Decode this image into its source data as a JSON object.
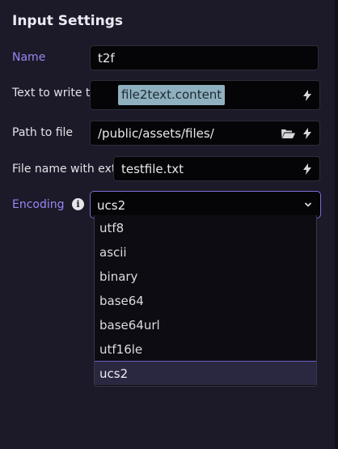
{
  "panel": {
    "title": "Input Settings"
  },
  "fields": {
    "name": {
      "label": "Name",
      "value": "t2f"
    },
    "text_to_write": {
      "label": "Text to write to file",
      "value": "file2text.content"
    },
    "path": {
      "label": "Path to file",
      "value": "/public/assets/files/"
    },
    "file_name": {
      "label": "File name with extn",
      "value": "testfile.txt"
    },
    "encoding": {
      "label": "Encoding",
      "value": "ucs2",
      "options": [
        "utf8",
        "ascii",
        "binary",
        "base64",
        "base64url",
        "utf16le",
        "ucs2"
      ]
    }
  },
  "icons": {
    "bolt": "lightning-bolt-icon",
    "folder": "folder-icon",
    "info": "info-icon",
    "chevron": "chevron-down-icon"
  },
  "colors": {
    "accent": "#9a86f4",
    "background": "#1c1a28",
    "input_bg": "#050507",
    "chip_bg": "#8fb0bf",
    "selected_option_bg": "#2a2740"
  }
}
